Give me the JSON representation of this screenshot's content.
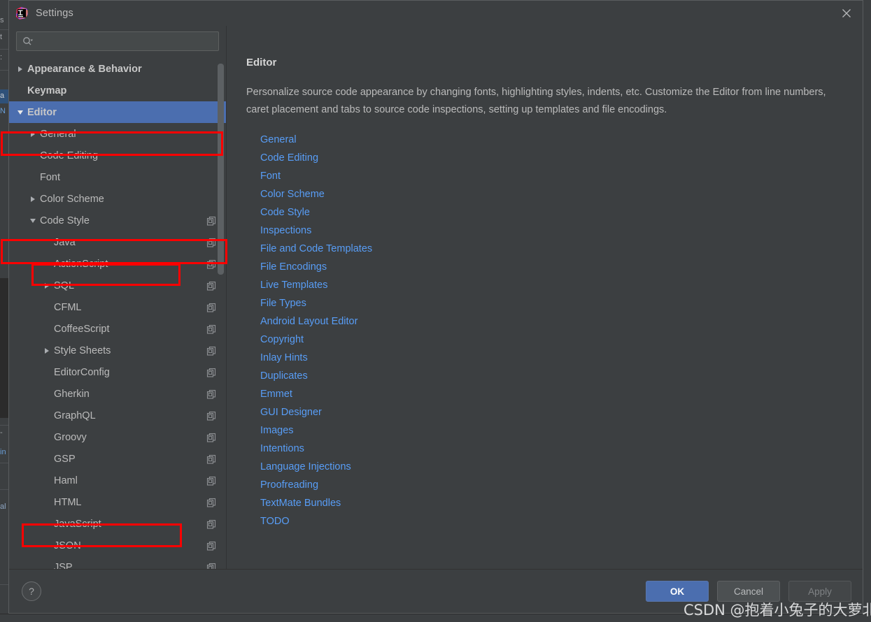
{
  "window": {
    "title": "Settings",
    "app_icon": "intellij-idea-icon",
    "close_icon": "close-icon"
  },
  "search": {
    "value": "",
    "placeholder": "",
    "icon": "search-icon"
  },
  "tree": {
    "items": [
      {
        "label": "Appearance & Behavior",
        "depth": 0,
        "twisty": "right",
        "bold": true,
        "selected": false,
        "copy": false
      },
      {
        "label": "Keymap",
        "depth": 0,
        "twisty": "none",
        "bold": true,
        "selected": false,
        "copy": false
      },
      {
        "label": "Editor",
        "depth": 0,
        "twisty": "down",
        "bold": true,
        "selected": true,
        "copy": false
      },
      {
        "label": "General",
        "depth": 1,
        "twisty": "right",
        "bold": false,
        "selected": false,
        "copy": false
      },
      {
        "label": "Code Editing",
        "depth": 1,
        "twisty": "none",
        "bold": false,
        "selected": false,
        "copy": false
      },
      {
        "label": "Font",
        "depth": 1,
        "twisty": "none",
        "bold": false,
        "selected": false,
        "copy": false
      },
      {
        "label": "Color Scheme",
        "depth": 1,
        "twisty": "right",
        "bold": false,
        "selected": false,
        "copy": false
      },
      {
        "label": "Code Style",
        "depth": 1,
        "twisty": "down",
        "bold": false,
        "selected": false,
        "copy": true
      },
      {
        "label": "Java",
        "depth": 2,
        "twisty": "none",
        "bold": false,
        "selected": false,
        "copy": true
      },
      {
        "label": "ActionScript",
        "depth": 2,
        "twisty": "none",
        "bold": false,
        "selected": false,
        "copy": true
      },
      {
        "label": "SQL",
        "depth": 2,
        "twisty": "right",
        "bold": false,
        "selected": false,
        "copy": true
      },
      {
        "label": "CFML",
        "depth": 2,
        "twisty": "none",
        "bold": false,
        "selected": false,
        "copy": true
      },
      {
        "label": "CoffeeScript",
        "depth": 2,
        "twisty": "none",
        "bold": false,
        "selected": false,
        "copy": true
      },
      {
        "label": "Style Sheets",
        "depth": 2,
        "twisty": "right",
        "bold": false,
        "selected": false,
        "copy": true
      },
      {
        "label": "EditorConfig",
        "depth": 2,
        "twisty": "none",
        "bold": false,
        "selected": false,
        "copy": true
      },
      {
        "label": "Gherkin",
        "depth": 2,
        "twisty": "none",
        "bold": false,
        "selected": false,
        "copy": true
      },
      {
        "label": "GraphQL",
        "depth": 2,
        "twisty": "none",
        "bold": false,
        "selected": false,
        "copy": true
      },
      {
        "label": "Groovy",
        "depth": 2,
        "twisty": "none",
        "bold": false,
        "selected": false,
        "copy": true
      },
      {
        "label": "GSP",
        "depth": 2,
        "twisty": "none",
        "bold": false,
        "selected": false,
        "copy": true
      },
      {
        "label": "Haml",
        "depth": 2,
        "twisty": "none",
        "bold": false,
        "selected": false,
        "copy": true
      },
      {
        "label": "HTML",
        "depth": 2,
        "twisty": "none",
        "bold": false,
        "selected": false,
        "copy": true
      },
      {
        "label": "JavaScript",
        "depth": 2,
        "twisty": "none",
        "bold": false,
        "selected": false,
        "copy": true
      },
      {
        "label": "JSON",
        "depth": 2,
        "twisty": "none",
        "bold": false,
        "selected": false,
        "copy": true
      },
      {
        "label": "JSP",
        "depth": 2,
        "twisty": "none",
        "bold": false,
        "selected": false,
        "copy": true
      }
    ]
  },
  "content": {
    "title": "Editor",
    "description": "Personalize source code appearance by changing fonts, highlighting styles, indents, etc. Customize the Editor from line numbers, caret placement and tabs to source code inspections, setting up templates and file encodings.",
    "links": [
      "General",
      "Code Editing",
      "Font",
      "Color Scheme",
      "Code Style",
      "Inspections",
      "File and Code Templates",
      "File Encodings",
      "Live Templates",
      "File Types",
      "Android Layout Editor",
      "Copyright",
      "Inlay Hints",
      "Duplicates",
      "Emmet",
      "GUI Designer",
      "Images",
      "Intentions",
      "Language Injections",
      "Proofreading",
      "TextMate Bundles",
      "TODO"
    ]
  },
  "footer": {
    "help_label": "?",
    "ok_label": "OK",
    "cancel_label": "Cancel",
    "apply_label": "Apply"
  },
  "watermark": {
    "text": "CSDN @抱着小兔子的大萝北"
  },
  "colors": {
    "dialog_bg": "#3c3f41",
    "selection_blue": "#4b6eaf",
    "link_blue": "#589df6",
    "text": "#bbbbbb",
    "annotation_red": "#ff0000"
  }
}
